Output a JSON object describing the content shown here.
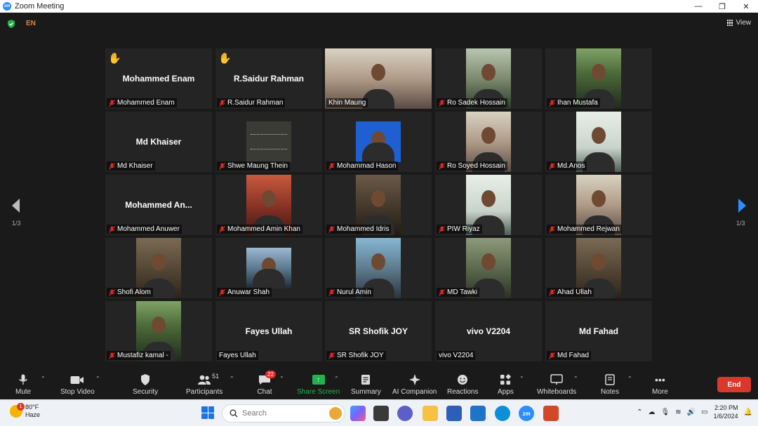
{
  "window": {
    "title": "Zoom Meeting",
    "min": "—",
    "max": "❐",
    "close": "✕"
  },
  "status": {
    "lang": "EN",
    "view_label": "View"
  },
  "gallery": {
    "page_indicator": "1/3",
    "tiles": [
      {
        "name": "Mohammed Enam",
        "big": "Mohammed Enam",
        "hand": true
      },
      {
        "name": "R.Saidur Rahman",
        "big": "R.Saidur Rahman",
        "hand": true
      },
      {
        "name": "Khin Maung",
        "video": "c",
        "full": true,
        "active": true
      },
      {
        "name": "Ro Sadek Hossain",
        "video": "a"
      },
      {
        "name": "Ihan Mustafa",
        "video": "b"
      },
      {
        "name": "Md Khaiser",
        "big": "Md Khaiser"
      },
      {
        "name": "Shwe Maung Thein",
        "video": "dark",
        "small": true
      },
      {
        "name": "Mohammad Hason",
        "video": "blue",
        "small": true
      },
      {
        "name": "Ro Soyed Hossain",
        "video": "c"
      },
      {
        "name": "Md.Anos",
        "video": "f"
      },
      {
        "name": "Mohammed Anuwer",
        "big": "Mohammed  An..."
      },
      {
        "name": "Mohammed Amin Khan",
        "video": "d"
      },
      {
        "name": "Mohammed Idris",
        "video": "e"
      },
      {
        "name": "PIW Riyaz",
        "video": "f"
      },
      {
        "name": "Mohammed Rejwan",
        "video": "c"
      },
      {
        "name": "Shofi Alom",
        "video": "j"
      },
      {
        "name": "Anuwar Shah",
        "video": "g",
        "small": true
      },
      {
        "name": "Nurul Amin",
        "video": "h"
      },
      {
        "name": "MD Tawki",
        "video": "i"
      },
      {
        "name": "Ahad Ullah",
        "video": "j"
      },
      {
        "name": "Mustafiz kamal -",
        "video": "b"
      },
      {
        "name": "Fayes Ullah",
        "big": "Fayes Ullah",
        "nomute": true
      },
      {
        "name": "SR Shofik JOY",
        "big": "SR Shofik JOY"
      },
      {
        "name": "vivo V2204",
        "big": "vivo V2204",
        "nomute": true
      },
      {
        "name": "Md Fahad",
        "big": "Md Fahad"
      }
    ]
  },
  "toolbar": {
    "mute": "Mute",
    "stop_video": "Stop Video",
    "security": "Security",
    "participants": "Participants",
    "participants_count": "51",
    "chat": "Chat",
    "chat_badge": "22",
    "share_screen": "Share Screen",
    "summary": "Summary",
    "ai_companion": "AI Companion",
    "reactions": "Reactions",
    "apps": "Apps",
    "whiteboards": "Whiteboards",
    "notes": "Notes",
    "more": "More",
    "end": "End"
  },
  "taskbar": {
    "temp": "80°F",
    "weather": "Haze",
    "weather_badge": "1",
    "search_placeholder": "Search",
    "time": "2:20 PM",
    "date": "1/6/2024"
  },
  "colors": {
    "active_speaker": "#e3e86a",
    "end_button": "#d8392b",
    "share_green": "#23b14d",
    "mute_red": "#e02828"
  }
}
